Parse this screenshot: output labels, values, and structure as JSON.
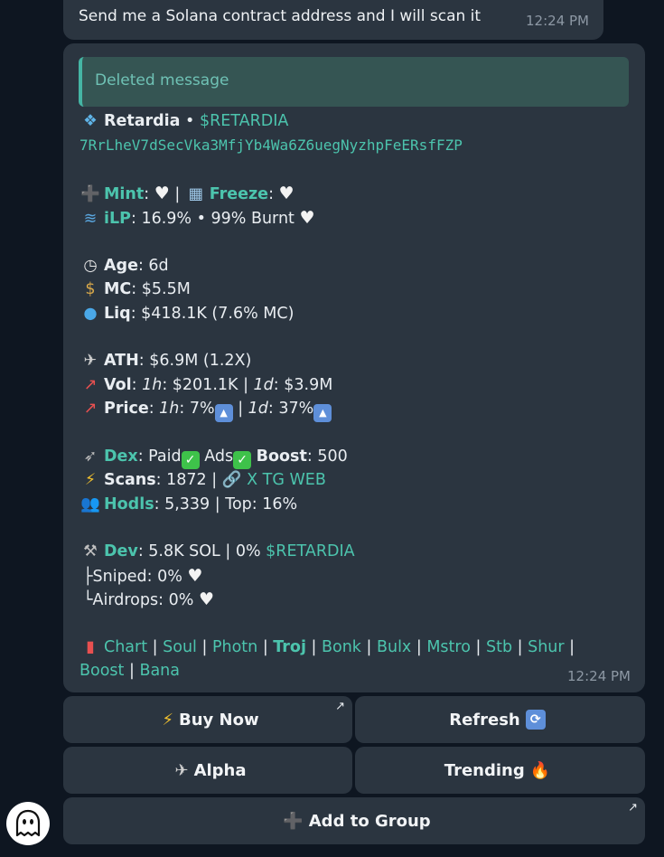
{
  "prev_message": {
    "text": "Send me a Solana contract address and I will scan it",
    "time": "12:24 PM"
  },
  "reply": {
    "text": "Deleted message"
  },
  "token": {
    "name": "Retardia",
    "ticker": "$RETARDIA",
    "address": "7RrLheV7dSecVka3MfjYb4Wa6Z6uegNyzhpFeERsfFZP"
  },
  "labels": {
    "mint": "Mint",
    "freeze": "Freeze",
    "ilp": "iLP",
    "age": "Age",
    "mc": "MC",
    "liq": "Liq",
    "ath": "ATH",
    "vol": "Vol",
    "price": "Price",
    "dex": "Dex",
    "ads": "Ads",
    "boost": "Boost",
    "scans": "Scans",
    "hodls": "Hodls",
    "top": "Top",
    "dev": "Dev",
    "sniped": "Sniped",
    "airdrops": "Airdrops",
    "h1": "1h",
    "d1": "1d"
  },
  "values": {
    "ilp": "16.9% • 99% Burnt",
    "age": "6d",
    "mc": "$5.5M",
    "liq": "$418.1K (7.6% MC)",
    "ath": "$6.9M (1.2X)",
    "vol_1h": "$201.1K",
    "vol_1d": "$3.9M",
    "price_1h": "7%",
    "price_1d": "37%",
    "dex": "Paid",
    "boost": "500",
    "scans": "1872",
    "links": "X TG WEB",
    "hodls": "5,339",
    "top": "16%",
    "dev_sol": "5.8K SOL",
    "dev_pct": "0%",
    "dev_ticker": "$RETARDIA",
    "sniped": "0%",
    "airdrops": "0%"
  },
  "link_row1": [
    "Chart",
    "Soul",
    "Photn",
    "Troj",
    "Bonk",
    "Bulx",
    "Mstro",
    "Stb",
    "Shur"
  ],
  "link_row2": [
    "Boost",
    "Bana"
  ],
  "time": "12:24 PM",
  "buttons": {
    "buy": "Buy Now",
    "refresh": "Refresh",
    "alpha": "Alpha",
    "trending": "Trending",
    "add_group": "Add to Group"
  },
  "icons": {
    "token": "diamond-icon",
    "mint": "plus-icon",
    "freeze": "ice-icon",
    "ilp": "wave-icon",
    "age": "clock-icon",
    "mc": "money-bag-icon",
    "liq": "droplet-icon",
    "ath": "eagle-icon",
    "vol": "chart-up-icon",
    "dex": "bird-icon",
    "scans": "lightning-icon",
    "hodls": "people-icon",
    "dev": "tools-icon",
    "links": "bar-chart-icon",
    "refresh": "repeat-icon",
    "trending": "fire-icon",
    "avatar": "ghost-icon"
  },
  "colors": {
    "bg": "#0e1621",
    "bubble": "#2b3540",
    "accent": "#4cc4ad",
    "reply_bg": "#355553"
  }
}
